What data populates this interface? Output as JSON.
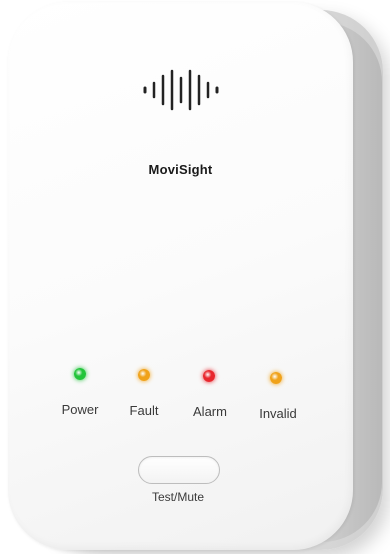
{
  "device": {
    "brand": "MoviSight",
    "indicators": [
      {
        "label": "Power",
        "color": "#22c43a"
      },
      {
        "label": "Fault",
        "color": "#f0a21a"
      },
      {
        "label": "Alarm",
        "color": "#e8262d"
      },
      {
        "label": "Invalid",
        "color": "#f0a21a"
      }
    ],
    "button_label": "Test/Mute"
  },
  "icons": {
    "speaker": "speaker-grille-icon"
  }
}
